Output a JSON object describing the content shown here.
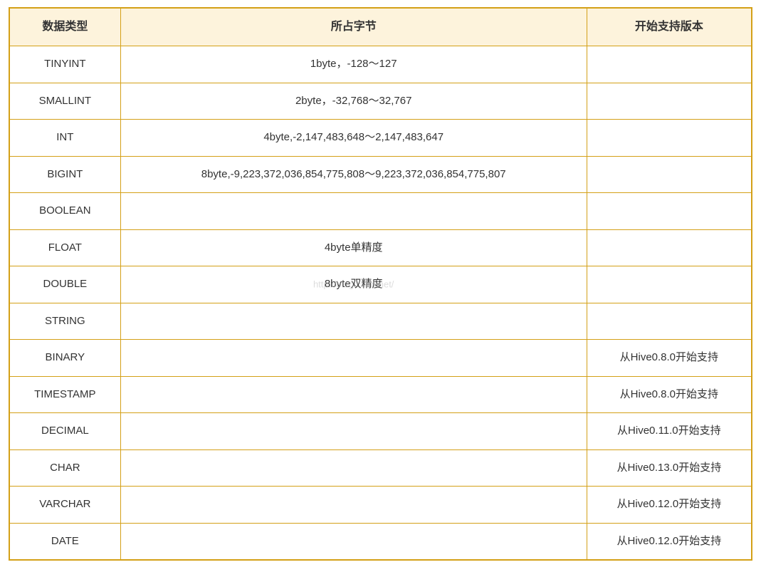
{
  "table": {
    "headers": [
      "数据类型",
      "所占字节",
      "开始支持版本"
    ],
    "rows": [
      {
        "type": "TINYINT",
        "bytes": "1byte，-128～127",
        "version": ""
      },
      {
        "type": "SMALLINT",
        "bytes": "2byte，-32,768～32,767",
        "version": ""
      },
      {
        "type": "INT",
        "bytes": "4byte,-2,147,483,648～2,147,483,647",
        "version": ""
      },
      {
        "type": "BIGINT",
        "bytes": "8byte,-9,223,372,036,854,775,808～9,223,372,036,854,775,807",
        "version": ""
      },
      {
        "type": "BOOLEAN",
        "bytes": "",
        "version": ""
      },
      {
        "type": "FLOAT",
        "bytes": "4byte单精度",
        "version": ""
      },
      {
        "type": "DOUBLE",
        "bytes": "8byte双精度",
        "version": ""
      },
      {
        "type": "STRING",
        "bytes": "",
        "version": ""
      },
      {
        "type": "BINARY",
        "bytes": "",
        "version": "从Hive0.8.0开始支持"
      },
      {
        "type": "TIMESTAMP",
        "bytes": "",
        "version": "从Hive0.8.0开始支持"
      },
      {
        "type": "DECIMAL",
        "bytes": "",
        "version": "从Hive0.11.0开始支持"
      },
      {
        "type": "CHAR",
        "bytes": "",
        "version": "从Hive0.13.0开始支持"
      },
      {
        "type": "VARCHAR",
        "bytes": "",
        "version": "从Hive0.12.0开始支持"
      },
      {
        "type": "DATE",
        "bytes": "",
        "version": "从Hive0.12.0开始支持"
      }
    ],
    "watermark": "http://blog.csdn.net/",
    "footer": ""
  }
}
